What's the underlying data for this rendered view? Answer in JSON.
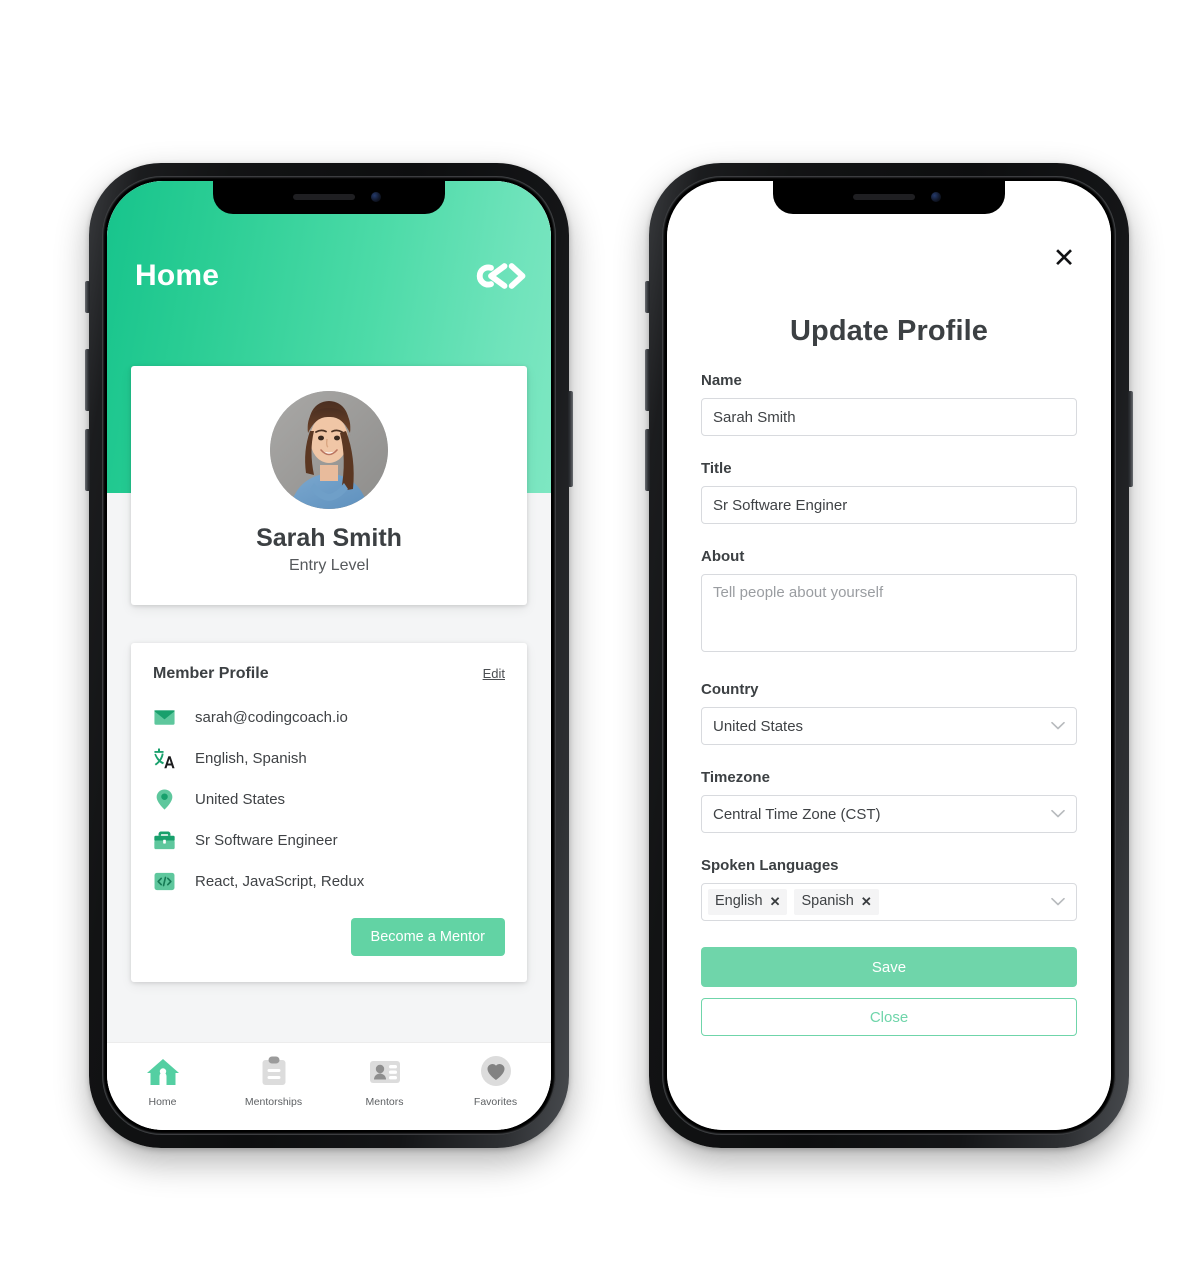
{
  "left_phone": {
    "header": {
      "title": "Home",
      "logo_icon": "codingcoach-brackets-logo"
    },
    "profile_card": {
      "avatar_icon": "user-avatar-photo",
      "name": "Sarah Smith",
      "level": "Entry Level"
    },
    "member_profile": {
      "heading": "Member Profile",
      "edit_label": "Edit",
      "rows": [
        {
          "icon": "envelope-icon",
          "text": "sarah@codingcoach.io"
        },
        {
          "icon": "translate-icon",
          "text": "English, Spanish"
        },
        {
          "icon": "location-pin-icon",
          "text": "United States"
        },
        {
          "icon": "briefcase-icon",
          "text": "Sr Software Engineer"
        },
        {
          "icon": "code-brackets-icon",
          "text": "React, JavaScript, Redux"
        }
      ],
      "become_mentor_label": "Become a Mentor"
    },
    "tabbar": [
      {
        "icon": "home-icon",
        "label": "Home",
        "active": true
      },
      {
        "icon": "clipboard-icon",
        "label": "Mentorships",
        "active": false
      },
      {
        "icon": "contact-card-icon",
        "label": "Mentors",
        "active": false
      },
      {
        "icon": "heart-icon",
        "label": "Favorites",
        "active": false
      }
    ]
  },
  "right_phone": {
    "close_icon_label": "✕",
    "title": "Update Profile",
    "fields": {
      "name": {
        "label": "Name",
        "value": "Sarah Smith"
      },
      "title": {
        "label": "Title",
        "value": "Sr Software Enginer"
      },
      "about": {
        "label": "About",
        "value": "",
        "placeholder": "Tell people about yourself"
      },
      "country": {
        "label": "Country",
        "value": "United States",
        "chevron_icon": "chevron-down-icon"
      },
      "timezone": {
        "label": "Timezone",
        "value": "Central Time Zone (CST)",
        "chevron_icon": "chevron-down-icon"
      },
      "languages": {
        "label": "Spoken Languages",
        "chips": [
          "English",
          "Spanish"
        ],
        "chip_remove_label": "✕",
        "chevron_icon": "chevron-down-icon"
      }
    },
    "save_label": "Save",
    "close_label": "Close"
  },
  "colors": {
    "green_dark": "#17c48c",
    "green_light": "#7ee7c2",
    "button_green": "#6fd5aa",
    "text_dark": "#3c4043",
    "border_gray": "#d8dade"
  }
}
